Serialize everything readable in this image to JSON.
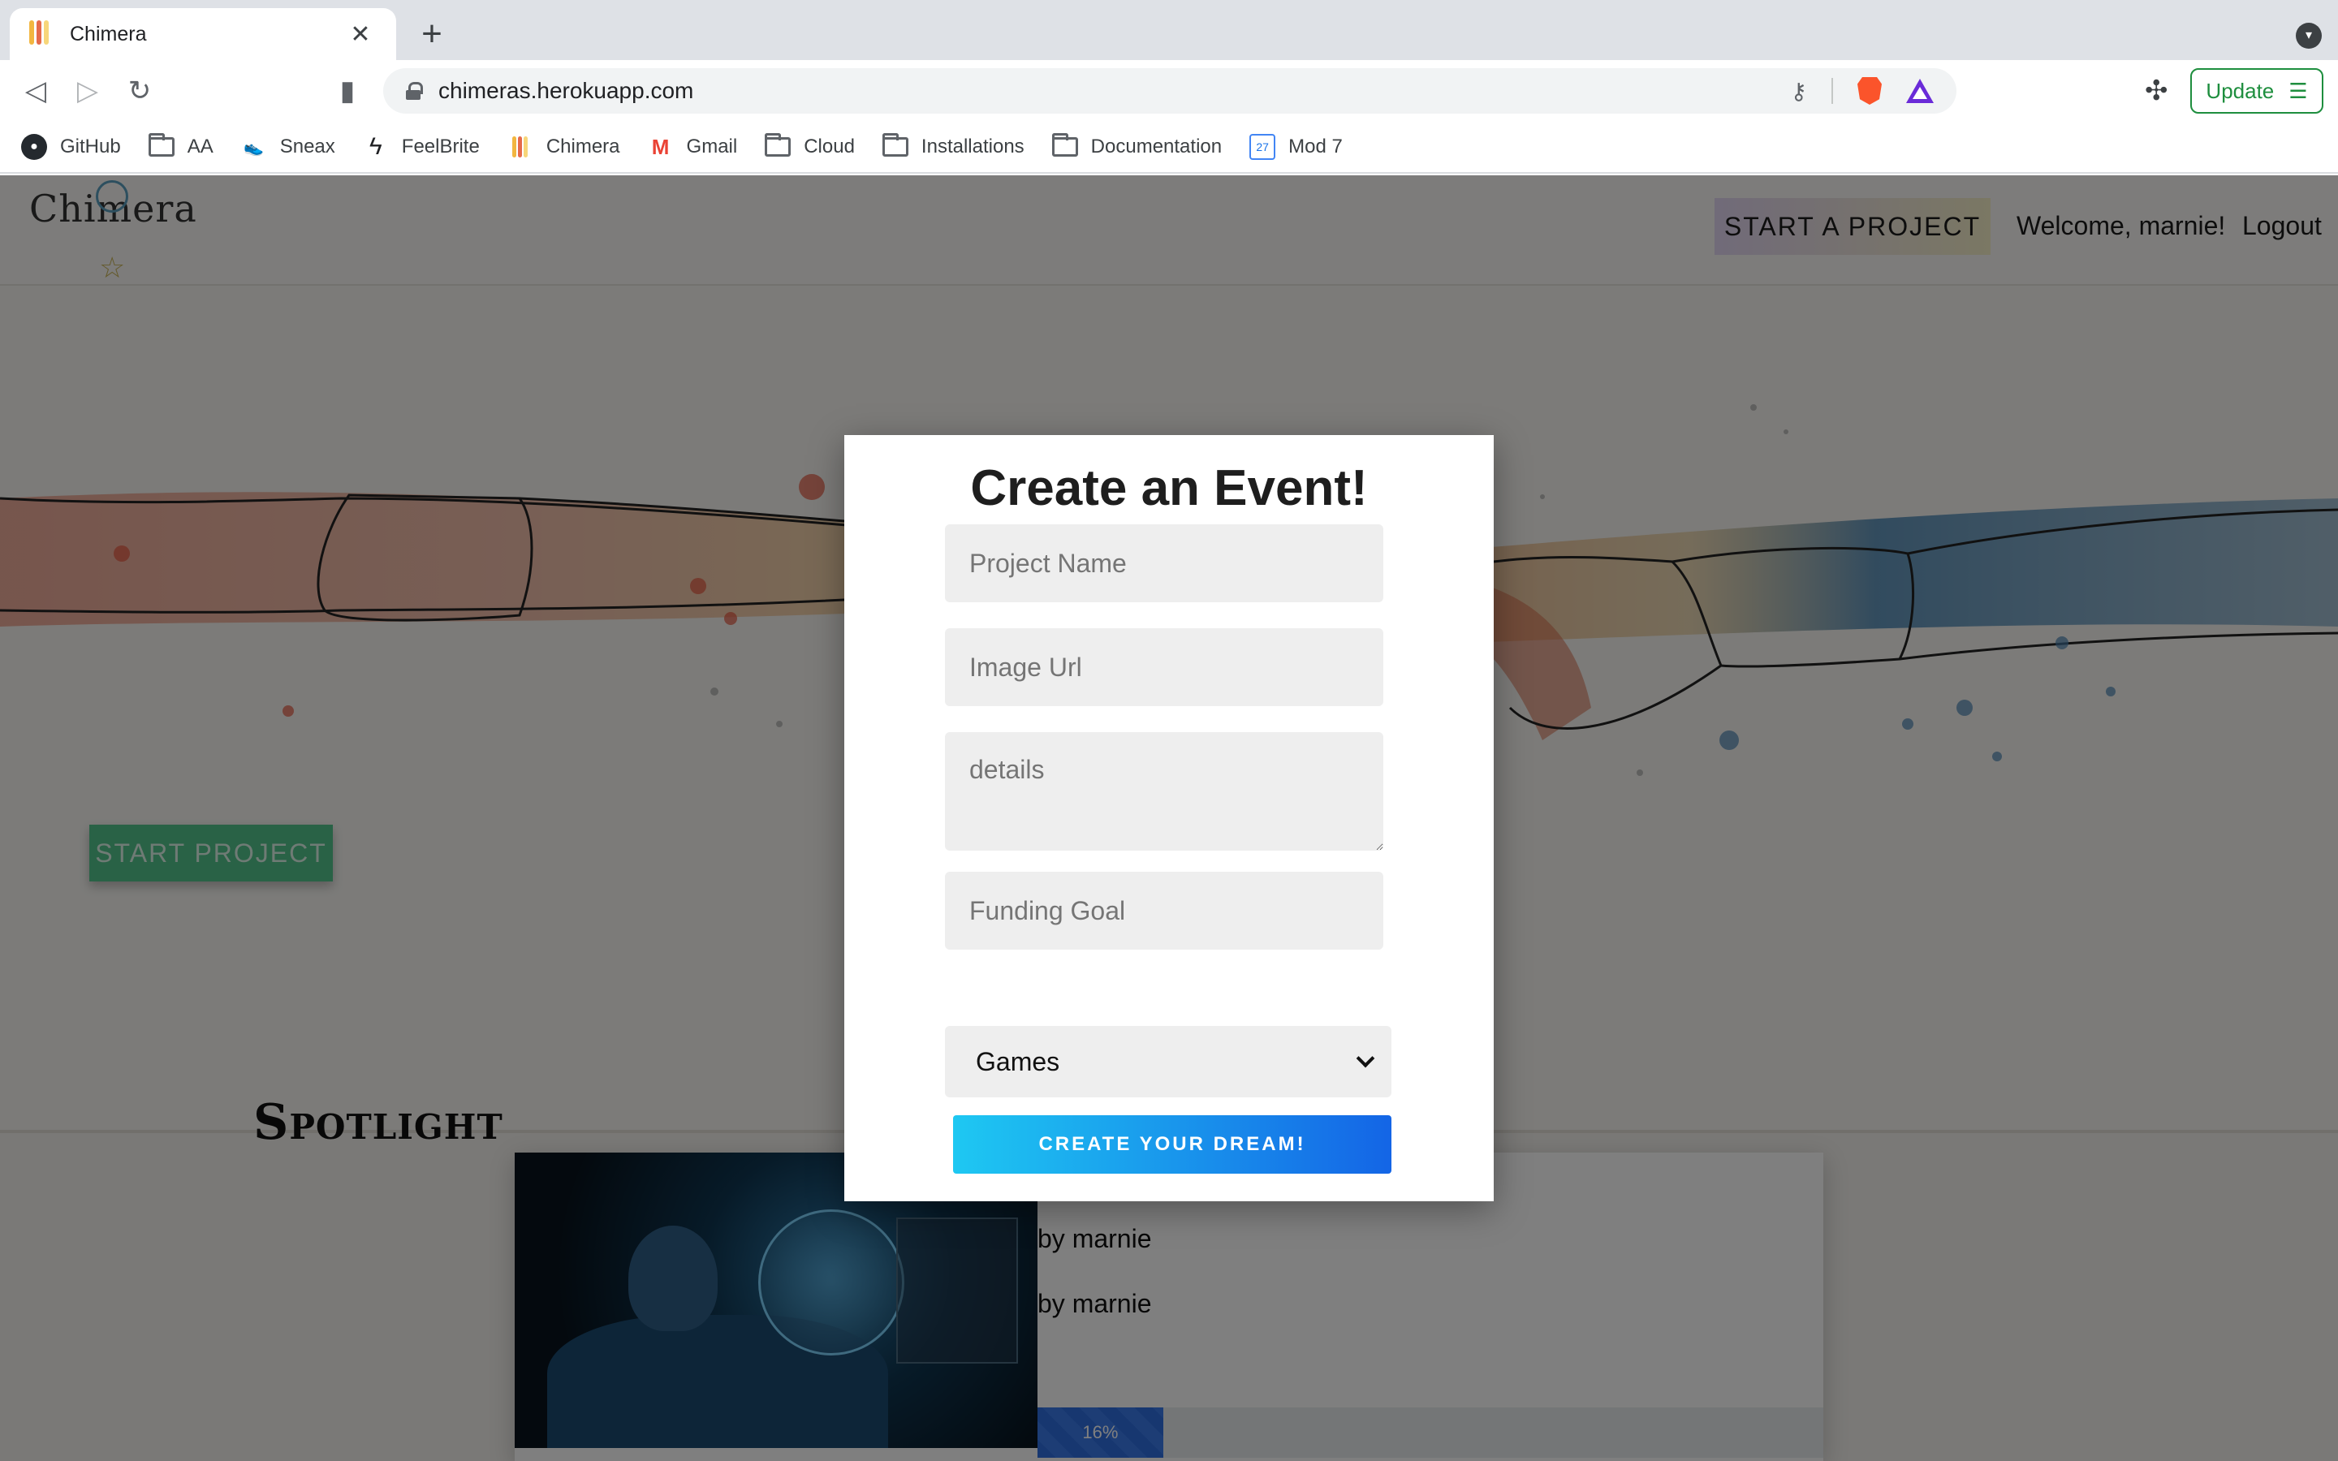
{
  "browser": {
    "tab_title": "Chimera",
    "tab_close": "✕",
    "new_tab": "+",
    "url": "chimeras.herokuapp.com",
    "update_label": "Update",
    "bookmarks": [
      {
        "label": "GitHub",
        "icon": "github-icon"
      },
      {
        "label": "AA",
        "icon": "folder-icon"
      },
      {
        "label": "Sneax",
        "icon": "shoe-icon"
      },
      {
        "label": "FeelBrite",
        "icon": "bolt-icon"
      },
      {
        "label": "Chimera",
        "icon": "chimera-logo-icon"
      },
      {
        "label": "Gmail",
        "icon": "gmail-icon"
      },
      {
        "label": "Cloud",
        "icon": "folder-icon"
      },
      {
        "label": "Installations",
        "icon": "folder-icon"
      },
      {
        "label": "Documentation",
        "icon": "folder-icon"
      },
      {
        "label": "Mod 7",
        "icon": "calendar-icon"
      }
    ],
    "calendar_day": "27"
  },
  "site": {
    "logo": "Chimera",
    "nav": {
      "start_a_project": "START A PROJECT",
      "welcome": "Welcome, marnie!",
      "logout": "Logout"
    },
    "hero": {
      "start_project": "START PROJECT"
    },
    "spotlight": {
      "title": "Spotlight",
      "card": {
        "byline_1": "by marnie",
        "byline_2": "by marnie",
        "progress_label": "16%",
        "progress_value": 16
      }
    }
  },
  "modal": {
    "title": "Create an Event!",
    "fields": {
      "project_name_placeholder": "Project Name",
      "image_url_placeholder": "Image Url",
      "details_placeholder": "details",
      "funding_goal_placeholder": "Funding Goal"
    },
    "category": {
      "selected": "Games"
    },
    "submit_label": "CREATE YOUR DREAM!"
  },
  "colors": {
    "modal_button_start": "#1ec8f2",
    "modal_button_end": "#1465e6",
    "hero_button": "#52c48c",
    "progress": "#2f6fe0"
  }
}
